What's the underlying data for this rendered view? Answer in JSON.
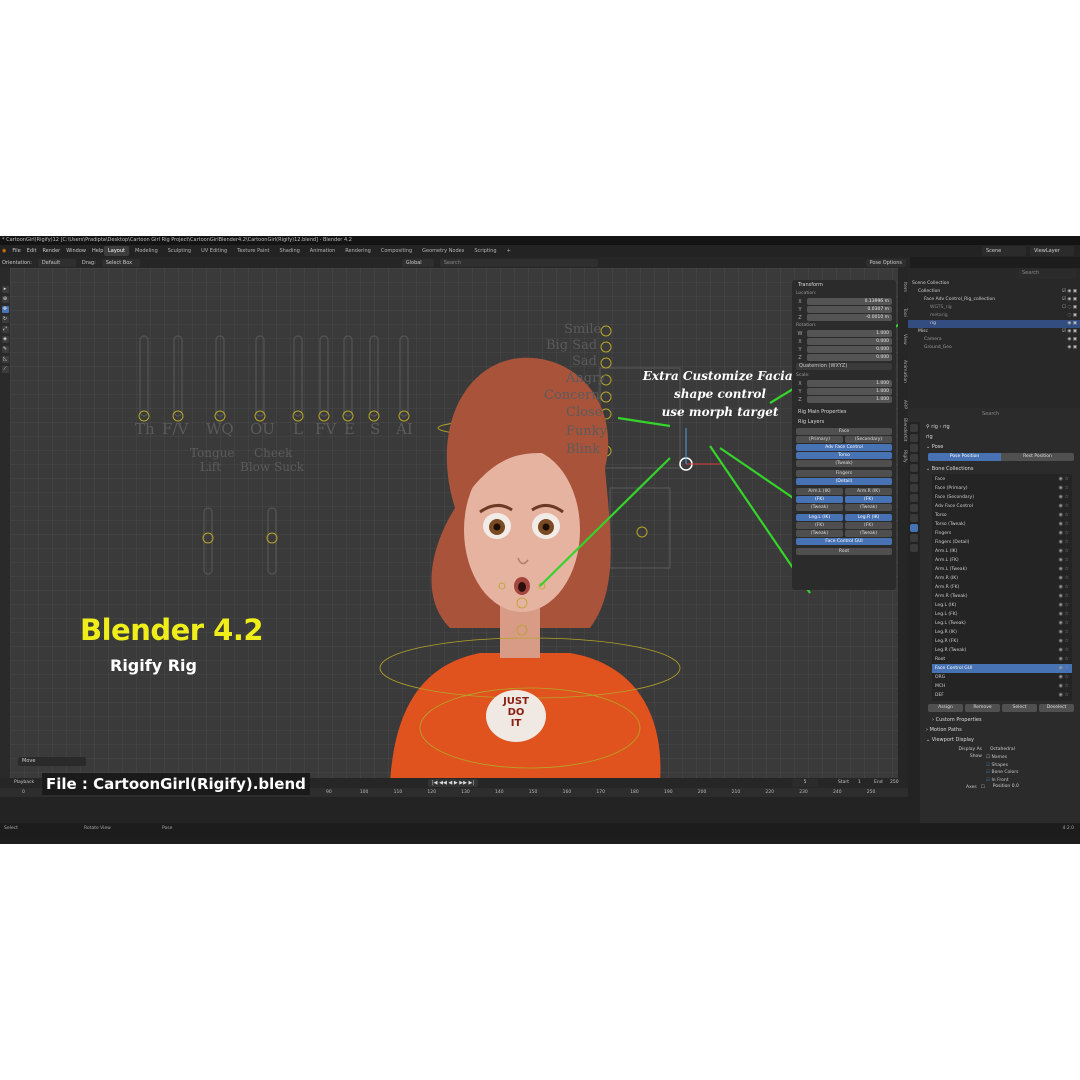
{
  "titlebar": {
    "text": "* CartoonGirl(Rigify)12 [C:\\Users\\Pradipta\\Desktop\\Cartoon Girl Rig Project\\CartoonGirlBlender4.2\\CartoonGirl(Rigify)12.blend] - Blender 4.2"
  },
  "menu": [
    "File",
    "Edit",
    "Render",
    "Window",
    "Help"
  ],
  "workspaces": [
    {
      "label": "Layout",
      "active": true
    },
    {
      "label": "Modeling"
    },
    {
      "label": "Sculpting"
    },
    {
      "label": "UV Editing"
    },
    {
      "label": "Texture Paint"
    },
    {
      "label": "Shading"
    },
    {
      "label": "Animation"
    },
    {
      "label": "Rendering"
    },
    {
      "label": "Compositing"
    },
    {
      "label": "Geometry Nodes"
    },
    {
      "label": "Scripting"
    }
  ],
  "top_right": {
    "scene": "Scene",
    "viewlayer": "ViewLayer"
  },
  "header": {
    "mode": "Pose Mode",
    "view": "View",
    "select": "Select",
    "pose": "Pose",
    "orientation_label": "Orientation:",
    "orientation": "Default",
    "drag_label": "Drag:",
    "drag": "Select Box",
    "transform": "Global",
    "search_placeholder": "Search",
    "pose_options": "Pose Options"
  },
  "overlay": {
    "title": "Blender 4.2",
    "subtitle": "Rigify Rig",
    "file": "File : CartoonGirl(Rigify).blend",
    "annotation_1": "Extra Customize Facial",
    "annotation_2": "shape control",
    "annotation_3": "use morph target",
    "shirt_text_1": "JUST",
    "shirt_text_2": "DO",
    "shirt_text_3": "IT"
  },
  "viewport_labels": {
    "left": [
      "Th",
      "F/V",
      "WQ",
      "OU",
      "L",
      "FV",
      "E",
      "S",
      "AI"
    ],
    "tongue": "Tongue",
    "lift": "Lift",
    "cheek": "Cheek",
    "blow_suck": "Blow Suck",
    "right": [
      "Smile",
      "Big Sad",
      "Sad",
      "Angry",
      "Concern",
      "Close",
      "Funky",
      "Blink"
    ],
    "move": "Move"
  },
  "npanel": {
    "transform": "Transform",
    "location_label": "Location:",
    "location": {
      "x": "0.13996 m",
      "y": "0.0307 m",
      "z": "-0.0010 m"
    },
    "rotation_label": "Rotation:",
    "rotation": {
      "w": "1.000",
      "x": "0.000",
      "y": "0.000",
      "z": "0.000"
    },
    "rot_mode": "Quaternion (WXYZ)",
    "scale_label": "Scale:",
    "scale": {
      "x": "1.000",
      "y": "1.000",
      "z": "1.000"
    },
    "axis_x": "X",
    "axis_y": "Y",
    "axis_z": "Z",
    "axis_w": "W",
    "rig_main": "Rig Main Properties",
    "rig_layers": "Rig Layers",
    "layers": {
      "face": "Face",
      "primary": "(Primary)",
      "secondary": "(Secondary)",
      "adv": "Adv Face Control",
      "torso": "Torso",
      "tweak": "(Tweak)",
      "fingers": "Fingers",
      "detail": "(Detail)",
      "arm_l_ik": "Arm.L (IK)",
      "arm_r_ik": "Arm.R (IK)",
      "fk": "(FK)",
      "leg_l_ik": "Leg.L (IK)",
      "leg_r_ik": "Leg.R (IK)",
      "face_ctrl": "Face Control GUI",
      "root": "Root"
    }
  },
  "side_tabs": [
    "Item",
    "Tool",
    "View",
    "Animation",
    "ARP",
    "BlenderKit",
    "Rigify"
  ],
  "outliner": {
    "search_placeholder": "Search",
    "rows": [
      {
        "label": "Scene Collection",
        "indent": 0
      },
      {
        "label": "Collection",
        "indent": 1
      },
      {
        "label": "Face Adv Control_Rig_collection",
        "indent": 2
      },
      {
        "label": "WGTS_rig",
        "indent": 3
      },
      {
        "label": "metarig",
        "indent": 3
      },
      {
        "label": "rig",
        "indent": 3,
        "selected": true
      },
      {
        "label": "Misc",
        "indent": 1
      },
      {
        "label": "Camera",
        "indent": 2
      },
      {
        "label": "Ground_Geo",
        "indent": 2
      }
    ]
  },
  "properties": {
    "search_placeholder": "Search",
    "breadcrumb_1": "rig",
    "breadcrumb_2": "rig",
    "data_name": "rig",
    "pose": "Pose",
    "pose_position": "Pose Position",
    "rest_position": "Rest Position",
    "bone_collections": "Bone Collections",
    "collections": [
      {
        "label": "Face"
      },
      {
        "label": "Face (Primary)"
      },
      {
        "label": "Face (Secondary)"
      },
      {
        "label": "Adv Face Control"
      },
      {
        "label": "Torso"
      },
      {
        "label": "Torso (Tweak)"
      },
      {
        "label": "Fingers"
      },
      {
        "label": "Fingers (Detail)"
      },
      {
        "label": "Arm.L (IK)"
      },
      {
        "label": "Arm.L (FK)"
      },
      {
        "label": "Arm.L (Tweak)"
      },
      {
        "label": "Arm.R (IK)"
      },
      {
        "label": "Arm.R (FK)"
      },
      {
        "label": "Arm.R (Tweak)"
      },
      {
        "label": "Leg.L (IK)"
      },
      {
        "label": "Leg.L (FK)"
      },
      {
        "label": "Leg.L (Tweak)"
      },
      {
        "label": "Leg.R (IK)"
      },
      {
        "label": "Leg.R (FK)"
      },
      {
        "label": "Leg.R (Tweak)"
      },
      {
        "label": "Root"
      },
      {
        "label": "Face Control GUI",
        "selected": true
      },
      {
        "label": "ORG"
      },
      {
        "label": "MCH"
      },
      {
        "label": "DEF"
      }
    ],
    "assign": "Assign",
    "remove": "Remove",
    "select": "Select",
    "deselect": "Deselect",
    "custom_props": "Custom Properties",
    "motion_paths": "Motion Paths",
    "viewport_display": "Viewport Display",
    "display_as_label": "Display As",
    "display_as": "Octahedral",
    "show_label": "Show",
    "names": "Names",
    "shapes": "Shapes",
    "bone_colors": "Bone Colors",
    "in_front": "In Front",
    "axes": "Axes",
    "position": "Position",
    "position_val": "0.0"
  },
  "timeline": {
    "playback": "Playback",
    "current": "5",
    "start_label": "Start",
    "start": "1",
    "end_label": "End",
    "end": "250",
    "ticks": [
      "0",
      "90",
      "100",
      "110",
      "120",
      "130",
      "140",
      "150",
      "160",
      "170",
      "180",
      "190",
      "200",
      "210",
      "220",
      "230",
      "240",
      "250"
    ]
  },
  "status": {
    "select": "Select",
    "rotate": "Rotate View",
    "pose": "Pose",
    "version": "4.2.0"
  },
  "colors": {
    "accent": "#4772b3",
    "annotation_line": "#35d42a",
    "title_yellow": "#f0ee1a",
    "shirt": "#e0531e"
  }
}
